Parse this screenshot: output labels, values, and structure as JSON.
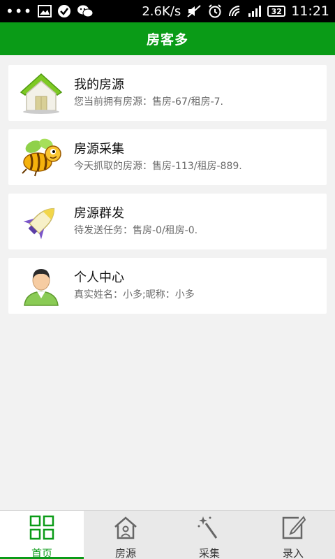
{
  "status_bar": {
    "dots": "•••",
    "speed": "2.6K/s",
    "battery": "32",
    "time": "11:21",
    "icons": [
      "image-icon",
      "check-circle-icon",
      "wechat-icon",
      "mute-icon",
      "alarm-icon",
      "wifi-icon",
      "signal-icon",
      "battery-icon"
    ]
  },
  "header": {
    "title": "房客多"
  },
  "cards": [
    {
      "title": "我的房源",
      "subtitle": "您当前拥有房源：售房-67/租房-7.",
      "icon": "house-icon"
    },
    {
      "title": "房源采集",
      "subtitle": "今天抓取的房源：售房-113/租房-889.",
      "icon": "bee-icon"
    },
    {
      "title": "房源群发",
      "subtitle": "待发送任务：售房-0/租房-0.",
      "icon": "rocket-icon"
    },
    {
      "title": "个人中心",
      "subtitle": "真实姓名：小多;昵称：小多",
      "icon": "person-icon"
    }
  ],
  "bottom_nav": {
    "items": [
      {
        "label": "首页",
        "icon": "grid-icon",
        "active": true
      },
      {
        "label": "房源",
        "icon": "house-outline-icon",
        "active": false
      },
      {
        "label": "采集",
        "icon": "magic-wand-icon",
        "active": false
      },
      {
        "label": "录入",
        "icon": "edit-icon",
        "active": false
      }
    ]
  },
  "colors": {
    "brand_green": "#0a9b17",
    "background": "#f2f2f2"
  }
}
